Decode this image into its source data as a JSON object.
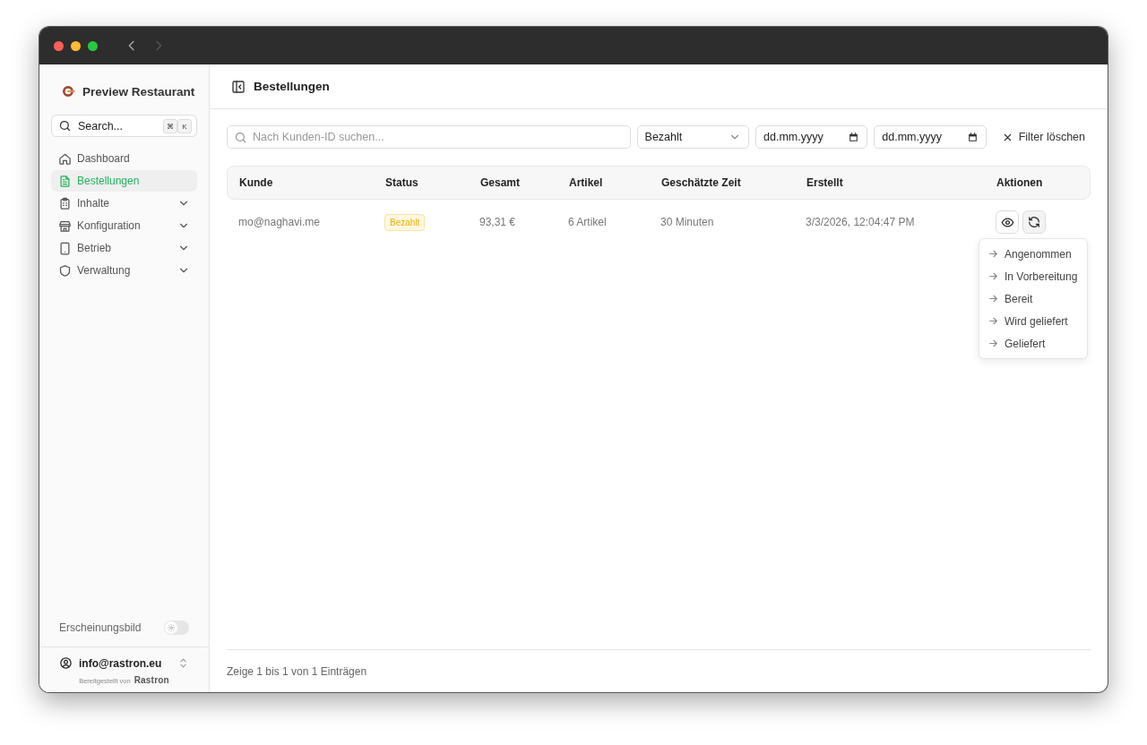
{
  "window": {
    "can_go_back": true,
    "can_go_forward": false
  },
  "sidebar": {
    "brand": "Preview Restaurant",
    "search": {
      "placeholder": "Search...",
      "shortcut": [
        "⌘",
        "K"
      ]
    },
    "items": [
      {
        "label": "Dashboard",
        "selected": false,
        "expandable": false
      },
      {
        "label": "Bestellungen",
        "selected": true,
        "expandable": false
      },
      {
        "label": "Inhalte",
        "selected": false,
        "expandable": true
      },
      {
        "label": "Konfiguration",
        "selected": false,
        "expandable": true
      },
      {
        "label": "Betrieb",
        "selected": false,
        "expandable": true
      },
      {
        "label": "Verwaltung",
        "selected": false,
        "expandable": true
      }
    ],
    "appearance": {
      "label": "Erscheinungsbild",
      "on": false
    },
    "account": "info@rastron.eu",
    "powered_by": "Bereitgestellt von",
    "powered_brand": "Rastron"
  },
  "main": {
    "title": "Bestellungen",
    "filters": {
      "search": {
        "placeholder": "Nach Kunden-ID suchen..."
      },
      "status": {
        "value": "Bezahlt"
      },
      "date_from": {
        "placeholder": "dd.mm.yyyy"
      },
      "date_to": {
        "placeholder": "dd.mm.yyyy"
      },
      "clear": "Filter löschen"
    },
    "table": {
      "columns": [
        "Kunde",
        "Status",
        "Gesamt",
        "Artikel",
        "Geschätzte Zeit",
        "Erstellt",
        "Aktionen"
      ],
      "rows": [
        {
          "customer": "mo@naghavi.me",
          "status": "Bezahlt",
          "total": "93,31 €",
          "items": "6 Artikel",
          "eta": "30 Minuten",
          "created": "3/3/2026, 12:04:47 PM",
          "menu_open": true,
          "status_menu": [
            "Angenommen",
            "In Vorbereitung",
            "Bereit",
            "Wird geliefert",
            "Geliefert"
          ]
        }
      ]
    },
    "footer": "Zeige 1 bis 1 von 1 Einträgen"
  }
}
